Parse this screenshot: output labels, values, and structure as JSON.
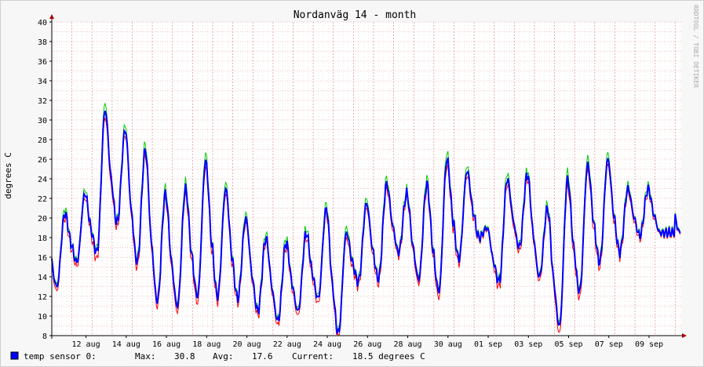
{
  "colors": {
    "background": "#f7f7f7",
    "plot_bg": "#ffffff",
    "grid": "#e08c8c",
    "avg_line": "#0000ff",
    "min_line": "#ff0000",
    "max_line": "#00cc00",
    "axis_arrow": "#aa0000",
    "watermark": "#aaaaaa"
  },
  "chart_data": {
    "type": "line",
    "title": "Nordanväg 14 - month",
    "ylabel": "degrees C",
    "watermark": "RRDTOOL / TOBI OETIKER",
    "ylim": [
      8,
      40
    ],
    "y_ticks": [
      8,
      10,
      12,
      14,
      16,
      18,
      20,
      22,
      24,
      26,
      28,
      30,
      32,
      34,
      36,
      38,
      40
    ],
    "x_range_days": [
      0,
      31.3
    ],
    "x_tick_labels": [
      "12 aug",
      "14 aug",
      "16 aug",
      "18 aug",
      "20 aug",
      "22 aug",
      "24 aug",
      "26 aug",
      "28 aug",
      "30 aug",
      "01 sep",
      "03 sep",
      "05 sep",
      "07 sep",
      "09 sep"
    ],
    "x_tick_days": [
      1.7,
      3.7,
      5.7,
      7.7,
      9.7,
      11.7,
      13.7,
      15.7,
      17.7,
      19.7,
      21.7,
      23.7,
      25.7,
      27.7,
      29.7
    ],
    "grid": true,
    "series": [
      {
        "name": "temp sensor 0",
        "role": "average",
        "day_min": [
          13,
          15.5,
          16.5,
          19.5,
          15.5,
          11.5,
          11,
          12,
          12,
          11.8,
          10.5,
          9.5,
          10.5,
          11.8,
          8.2,
          13.5,
          13.8,
          16.5,
          13.8,
          12.5,
          15.8,
          18,
          13.5,
          17,
          14,
          9,
          12.5,
          15.5,
          16.5,
          18.2,
          18.5
        ],
        "day_max": [
          20.5,
          22.5,
          31,
          29,
          27,
          22.5,
          23,
          25.8,
          23,
          20,
          18,
          17.5,
          18.5,
          21,
          18.5,
          21.5,
          23.5,
          22.5,
          23.5,
          26,
          24.8,
          19,
          24,
          24.5,
          21,
          24,
          25.5,
          26,
          23,
          23,
          18.5
        ]
      }
    ],
    "legend": {
      "series_name": "temp sensor 0:",
      "max_label": "Max:",
      "max_value": "30.8",
      "avg_label": "Avg:",
      "avg_value": "17.6",
      "current_label": "Current:",
      "current_value": "18.5 degrees C",
      "placement": "bottom-left"
    }
  }
}
